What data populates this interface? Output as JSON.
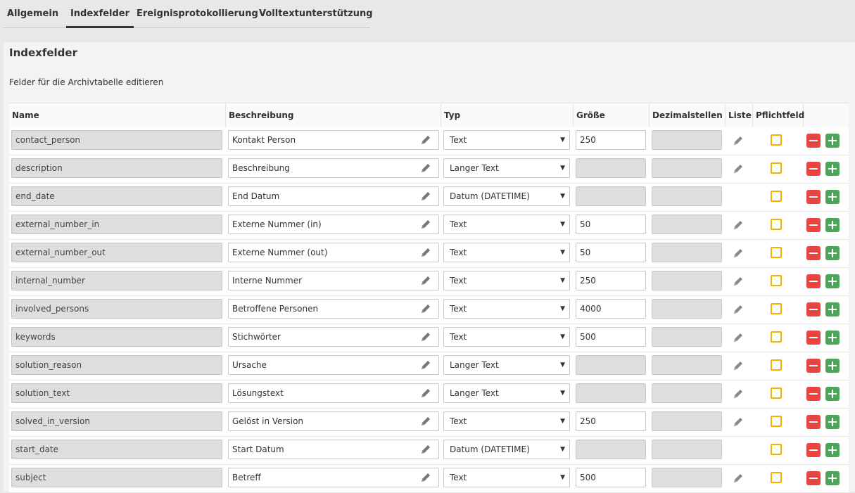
{
  "tabs": [
    {
      "label": "Allgemein",
      "active": false
    },
    {
      "label": "Indexfelder",
      "active": true
    },
    {
      "label": "Ereignisprotokollierung",
      "active": false
    },
    {
      "label": "Volltextunterstützung",
      "active": false
    }
  ],
  "panel": {
    "title": "Indexfelder",
    "subtitle": "Felder für die Archivtabelle editieren"
  },
  "columns": {
    "name": "Name",
    "description": "Beschreibung",
    "type": "Typ",
    "size": "Größe",
    "decimals": "Dezimalstellen",
    "list": "Liste",
    "required": "Pflichtfeld"
  },
  "rows": [
    {
      "name": "contact_person",
      "description": "Kontakt Person",
      "type": "Text",
      "size": "250",
      "list_editable": true
    },
    {
      "name": "description",
      "description": "Beschreibung",
      "type": "Langer Text",
      "size": "",
      "list_editable": true
    },
    {
      "name": "end_date",
      "description": "End Datum",
      "type": "Datum (DATETIME)",
      "size": "",
      "list_editable": false
    },
    {
      "name": "external_number_in",
      "description": "Externe Nummer (in)",
      "type": "Text",
      "size": "50",
      "list_editable": true
    },
    {
      "name": "external_number_out",
      "description": "Externe Nummer (out)",
      "type": "Text",
      "size": "50",
      "list_editable": true
    },
    {
      "name": "internal_number",
      "description": "Interne Nummer",
      "type": "Text",
      "size": "250",
      "list_editable": true
    },
    {
      "name": "involved_persons",
      "description": "Betroffene Personen",
      "type": "Text",
      "size": "4000",
      "list_editable": true
    },
    {
      "name": "keywords",
      "description": "Stichwörter",
      "type": "Text",
      "size": "500",
      "list_editable": true
    },
    {
      "name": "solution_reason",
      "description": "Ursache",
      "type": "Langer Text",
      "size": "",
      "list_editable": true
    },
    {
      "name": "solution_text",
      "description": "Lösungstext",
      "type": "Langer Text",
      "size": "",
      "list_editable": true
    },
    {
      "name": "solved_in_version",
      "description": "Gelöst in Version",
      "type": "Text",
      "size": "250",
      "list_editable": true
    },
    {
      "name": "start_date",
      "description": "Start Datum",
      "type": "Datum (DATETIME)",
      "size": "",
      "list_editable": false
    },
    {
      "name": "subject",
      "description": "Betreff",
      "type": "Text",
      "size": "500",
      "list_editable": true
    }
  ],
  "icons": {
    "edit": "pencil-icon",
    "required": "checkbox-icon",
    "remove": "minus-icon",
    "add": "plus-icon",
    "select": "caret-down-icon"
  },
  "colors": {
    "remove_button": "#e8433e",
    "add_button": "#4ca55a",
    "required_border": "#f0b400",
    "readonly_field": "#dedede"
  }
}
